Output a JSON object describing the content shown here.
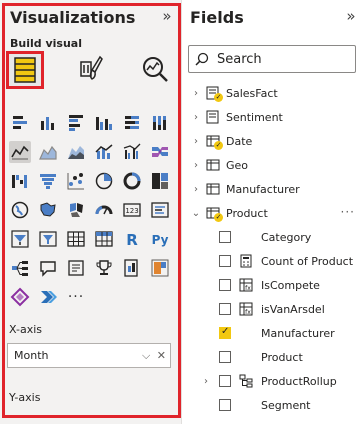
{
  "viz": {
    "title": "Visualizations",
    "collapse_icon": "double-chevron-right",
    "build_label": "Build visual",
    "modes": [
      {
        "name": "build-visual",
        "active": true
      },
      {
        "name": "format-visual",
        "active": false
      },
      {
        "name": "analytics",
        "active": false
      }
    ],
    "wells": {
      "x_axis_label": "X-axis",
      "x_axis_value": "Month",
      "y_axis_label": "Y-axis"
    },
    "more_label": "···"
  },
  "fields": {
    "title": "Fields",
    "collapse_icon": "double-chevron-right",
    "search_placeholder": "Search",
    "tables": [
      {
        "label": "SalesFact",
        "has_checked": true,
        "expanded": false
      },
      {
        "label": "Sentiment",
        "has_checked": false,
        "expanded": false
      },
      {
        "label": "Date",
        "has_checked": true,
        "expanded": false
      },
      {
        "label": "Geo",
        "has_checked": false,
        "expanded": false
      },
      {
        "label": "Manufacturer",
        "has_checked": false,
        "expanded": false
      },
      {
        "label": "Product",
        "has_checked": true,
        "expanded": true
      }
    ],
    "product_fields": [
      {
        "label": "Category",
        "checked": false,
        "icon": "none"
      },
      {
        "label": "Count of Product",
        "checked": false,
        "icon": "calculator"
      },
      {
        "label": "IsCompete",
        "checked": false,
        "icon": "calculated-column"
      },
      {
        "label": "isVanArsdel",
        "checked": false,
        "icon": "calculated-column"
      },
      {
        "label": "Manufacturer",
        "checked": true,
        "icon": "none"
      },
      {
        "label": "Product",
        "checked": false,
        "icon": "none"
      },
      {
        "label": "ProductRollup",
        "checked": false,
        "icon": "hierarchy",
        "expandable": true
      },
      {
        "label": "Segment",
        "checked": false,
        "icon": "none"
      }
    ],
    "more_options": "···"
  },
  "colors": {
    "accent_yellow": "#f2c811",
    "highlight_red": "#e0242b",
    "pane_gray": "#f3f2f1"
  }
}
